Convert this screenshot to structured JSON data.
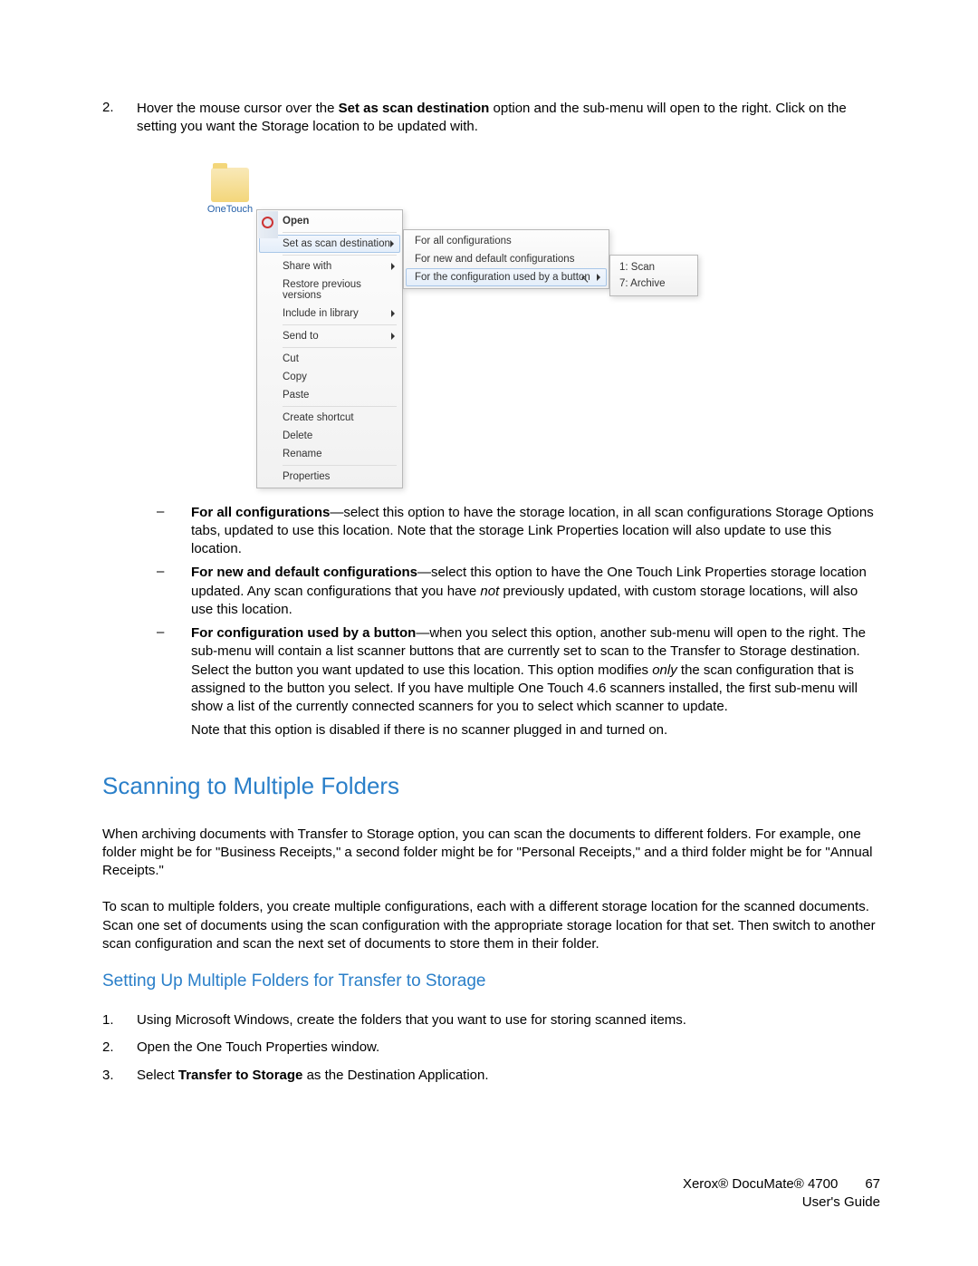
{
  "step2": {
    "num": "2.",
    "text_before": "Hover the mouse cursor over the ",
    "bold": "Set as scan destination",
    "text_after": " option and the sub-menu will open to the right. Click on the setting you want the Storage location to be updated with."
  },
  "folder": {
    "label": "OneTouch"
  },
  "contextMenu": {
    "open": "Open",
    "setAsScan": "Set as scan destination",
    "shareWith": "Share with",
    "restore": "Restore previous versions",
    "includeLib": "Include in library",
    "sendTo": "Send to",
    "cut": "Cut",
    "copy": "Copy",
    "paste": "Paste",
    "createShortcut": "Create shortcut",
    "delete": "Delete",
    "rename": "Rename",
    "properties": "Properties"
  },
  "submenu1": {
    "forAll": "For all configurations",
    "forNew": "For new and default configurations",
    "forButton": "For the configuration used by a button"
  },
  "submenu2": {
    "scan": "1: Scan",
    "archive": "7: Archive"
  },
  "bullets": {
    "b1_bold": "For all configurations",
    "b1_text": "—select this option to have the storage location, in all scan configurations Storage Options tabs, updated to use this location. Note that the storage Link Properties location will also update to use this location.",
    "b2_bold": "For new and default configurations",
    "b2_text_a": "—select this option to have the One Touch Link Properties storage location updated. Any scan configurations that you have ",
    "b2_italic": "not",
    "b2_text_b": " previously updated, with custom storage locations, will also use this location.",
    "b3_bold": "For configuration used by a button",
    "b3_text_a": "—when you select this option, another sub-menu will open to the right. The sub-menu will contain a list scanner buttons that are currently set to scan to the Transfer to Storage destination. Select the button you want updated to use this location. This option modifies ",
    "b3_italic": "only",
    "b3_text_b": " the scan configuration that is assigned to the button you select. If you have multiple One Touch 4.6 scanners installed, the first sub-menu will show a list of the currently connected scanners for you to select which scanner to update.",
    "b3_note": "Note that this option is disabled if there is no scanner plugged in and turned on."
  },
  "h1": "Scanning to Multiple Folders",
  "para1": "When archiving documents with Transfer to Storage option, you can scan the documents to different folders. For example, one folder might be for \"Business Receipts,\" a second folder might be for \"Personal Receipts,\" and a third folder might be for \"Annual Receipts.\"",
  "para2": "To scan to multiple folders, you create multiple configurations, each with a different storage location for the scanned documents. Scan one set of documents using the scan configuration with the appropriate storage location for that set. Then switch to another scan configuration and scan the next set of documents to store them in their folder.",
  "h2": "Setting Up Multiple Folders for Transfer to Storage",
  "ol": {
    "i1_num": "1.",
    "i1_text": "Using Microsoft Windows, create the folders that you want to use for storing scanned items.",
    "i2_num": "2.",
    "i2_text": "Open the One Touch Properties window.",
    "i3_num": "3.",
    "i3_text_a": "Select ",
    "i3_bold": "Transfer to Storage",
    "i3_text_b": " as the Destination Application."
  },
  "footer": {
    "product": "Xerox® DocuMate® 4700",
    "page": "67",
    "guide": "User's Guide"
  }
}
